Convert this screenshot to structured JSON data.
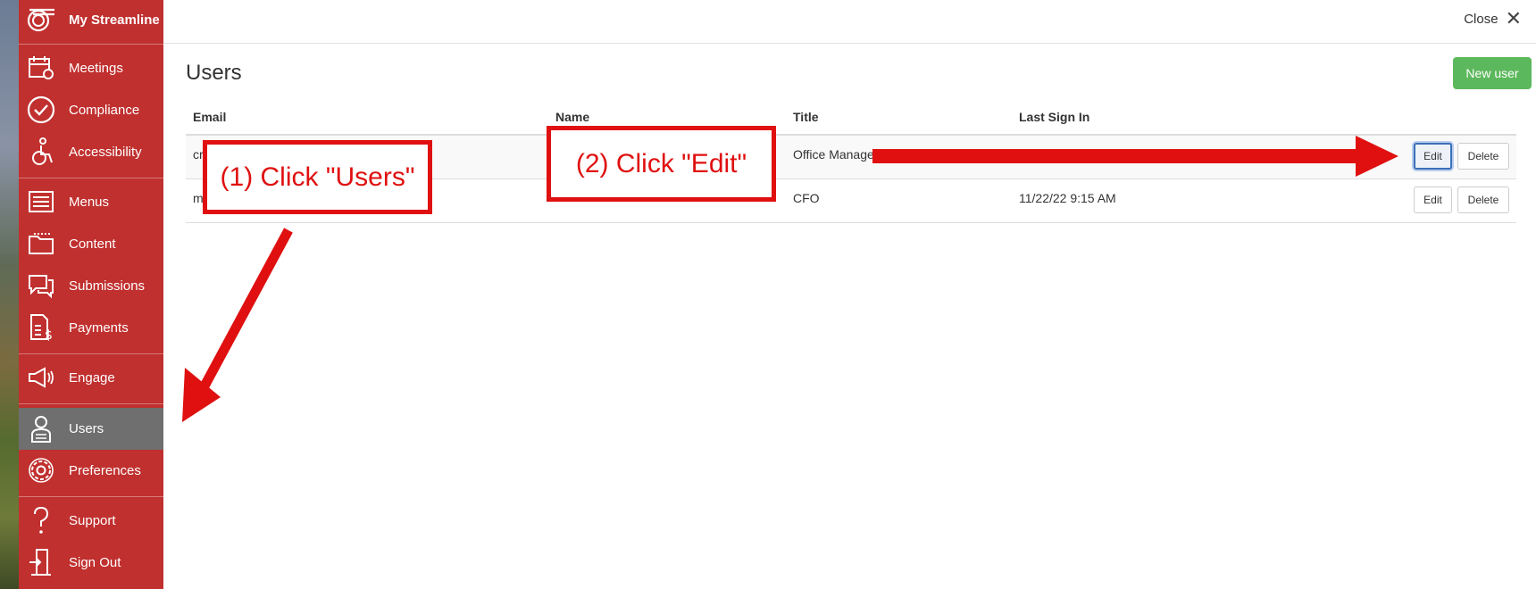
{
  "sidebar": {
    "brand": "My Streamline",
    "items": [
      {
        "label": "Meetings",
        "icon": "calendar-icon"
      },
      {
        "label": "Compliance",
        "icon": "checkmark-circle-icon"
      },
      {
        "label": "Accessibility",
        "icon": "wheelchair-icon"
      },
      {
        "label": "Menus",
        "icon": "menu-list-icon"
      },
      {
        "label": "Content",
        "icon": "folder-icon"
      },
      {
        "label": "Submissions",
        "icon": "chat-bubbles-icon"
      },
      {
        "label": "Payments",
        "icon": "invoice-dollar-icon"
      },
      {
        "label": "Engage",
        "icon": "megaphone-icon"
      },
      {
        "label": "Users",
        "icon": "user-icon",
        "active": true
      },
      {
        "label": "Preferences",
        "icon": "gear-icon"
      },
      {
        "label": "Support",
        "icon": "question-icon"
      },
      {
        "label": "Sign Out",
        "icon": "door-exit-icon"
      }
    ]
  },
  "topbar": {
    "close_label": "Close"
  },
  "page": {
    "title": "Users",
    "new_user_label": "New user"
  },
  "table": {
    "headers": [
      "Email",
      "Name",
      "Title",
      "Last Sign In"
    ],
    "rows": [
      {
        "email": "cr",
        "name": "",
        "title": "Office Manage",
        "last_sign_in": "",
        "edit": "Edit",
        "delete": "Delete"
      },
      {
        "email": "m",
        "name": "",
        "title": "CFO",
        "last_sign_in": "11/22/22 9:15 AM",
        "edit": "Edit",
        "delete": "Delete"
      }
    ]
  },
  "annotations": {
    "step1": "(1) Click \"Users\"",
    "step2": "(2) Click \"Edit\""
  },
  "colors": {
    "sidebar_bg": "#c0302f",
    "sidebar_active": "#6f6f6f",
    "new_user_btn": "#5cb85c",
    "annotation_red": "#e01010"
  }
}
